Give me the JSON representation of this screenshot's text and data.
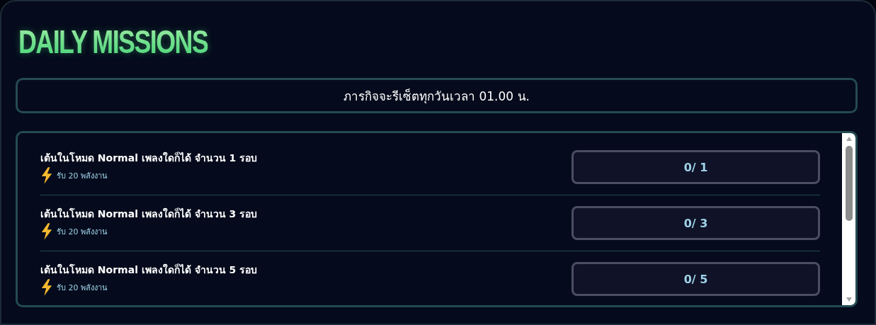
{
  "heading": "DAILY MISSIONS",
  "notice": "ภารกิจจะรีเซ็ตทุกวันเวลา 01.00 น.",
  "missions": [
    {
      "title": "เต้นในโหมด Normal เพลงใดก็ได้ จำนวน 1 รอบ",
      "reward": "รับ 20 พลังงาน",
      "progress": "0/ 1"
    },
    {
      "title": "เต้นในโหมด Normal เพลงใดก็ได้ จำนวน 3 รอบ",
      "reward": "รับ 20 พลังงาน",
      "progress": "0/ 3"
    },
    {
      "title": "เต้นในโหมด Normal เพลงใดก็ได้ จำนวน 5 รอบ",
      "reward": "รับ 20 พลังงาน",
      "progress": "0/ 5"
    }
  ]
}
